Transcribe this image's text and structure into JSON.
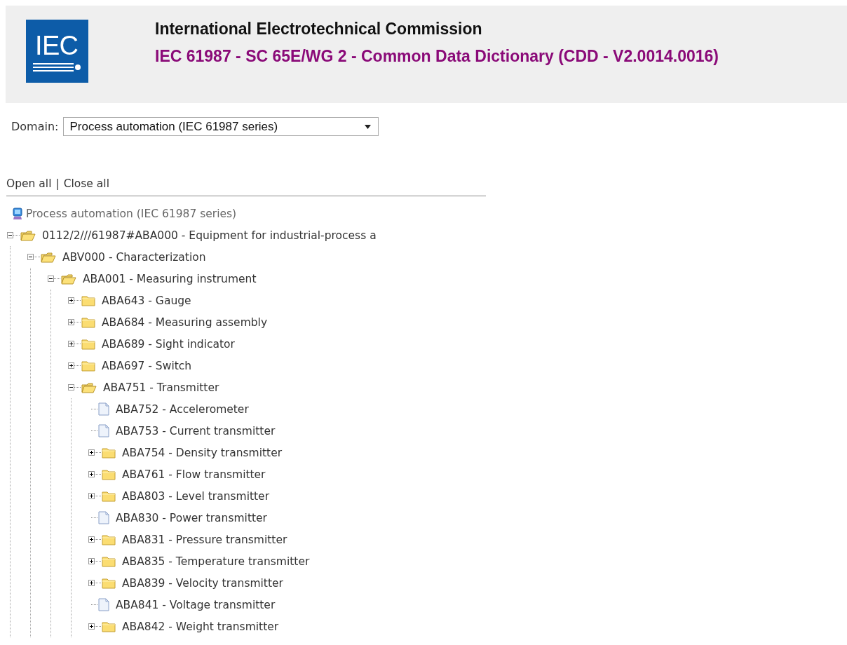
{
  "header": {
    "logo_text": "IEC",
    "title": "International Electrotechnical Commission",
    "subtitle": "IEC 61987 - SC 65E/WG 2 - Common Data Dictionary (CDD - V2.0014.0016)"
  },
  "domain": {
    "label": "Domain:",
    "value": "Process automation (IEC 61987 series)"
  },
  "tree_links": {
    "open_all": "Open all",
    "separator": "|",
    "close_all": "Close all"
  },
  "tree": {
    "root": "Process automation (IEC 61987 series)",
    "children": [
      {
        "kind": "folder",
        "label": "0112/2///61987#ABA000 - Equipment for industrial-process a",
        "expanded": true,
        "children": [
          {
            "kind": "folder",
            "label": "ABV000 - Characterization",
            "expanded": true,
            "children": [
              {
                "kind": "folder",
                "label": "ABA001 - Measuring instrument",
                "expanded": true,
                "children": [
                  {
                    "kind": "folder",
                    "label": "ABA643 - Gauge",
                    "expanded": false
                  },
                  {
                    "kind": "folder",
                    "label": "ABA684 - Measuring assembly",
                    "expanded": false
                  },
                  {
                    "kind": "folder",
                    "label": "ABA689 - Sight indicator",
                    "expanded": false
                  },
                  {
                    "kind": "folder",
                    "label": "ABA697 - Switch",
                    "expanded": false
                  },
                  {
                    "kind": "folder",
                    "label": "ABA751 - Transmitter",
                    "expanded": true,
                    "children": [
                      {
                        "kind": "document",
                        "label": "ABA752 - Accelerometer"
                      },
                      {
                        "kind": "document",
                        "label": "ABA753 - Current transmitter"
                      },
                      {
                        "kind": "folder",
                        "label": "ABA754 - Density transmitter",
                        "expanded": false
                      },
                      {
                        "kind": "folder",
                        "label": "ABA761 - Flow transmitter",
                        "expanded": false
                      },
                      {
                        "kind": "folder",
                        "label": "ABA803 - Level transmitter",
                        "expanded": false
                      },
                      {
                        "kind": "document",
                        "label": "ABA830 - Power transmitter"
                      },
                      {
                        "kind": "folder",
                        "label": "ABA831 - Pressure transmitter",
                        "expanded": false
                      },
                      {
                        "kind": "folder",
                        "label": "ABA835 - Temperature transmitter",
                        "expanded": false
                      },
                      {
                        "kind": "folder",
                        "label": "ABA839 - Velocity transmitter",
                        "expanded": false
                      },
                      {
                        "kind": "document",
                        "label": "ABA841 - Voltage transmitter"
                      },
                      {
                        "kind": "folder",
                        "label": "ABA842 - Weight transmitter",
                        "expanded": false
                      }
                    ]
                  }
                ]
              }
            ]
          }
        ]
      }
    ]
  }
}
